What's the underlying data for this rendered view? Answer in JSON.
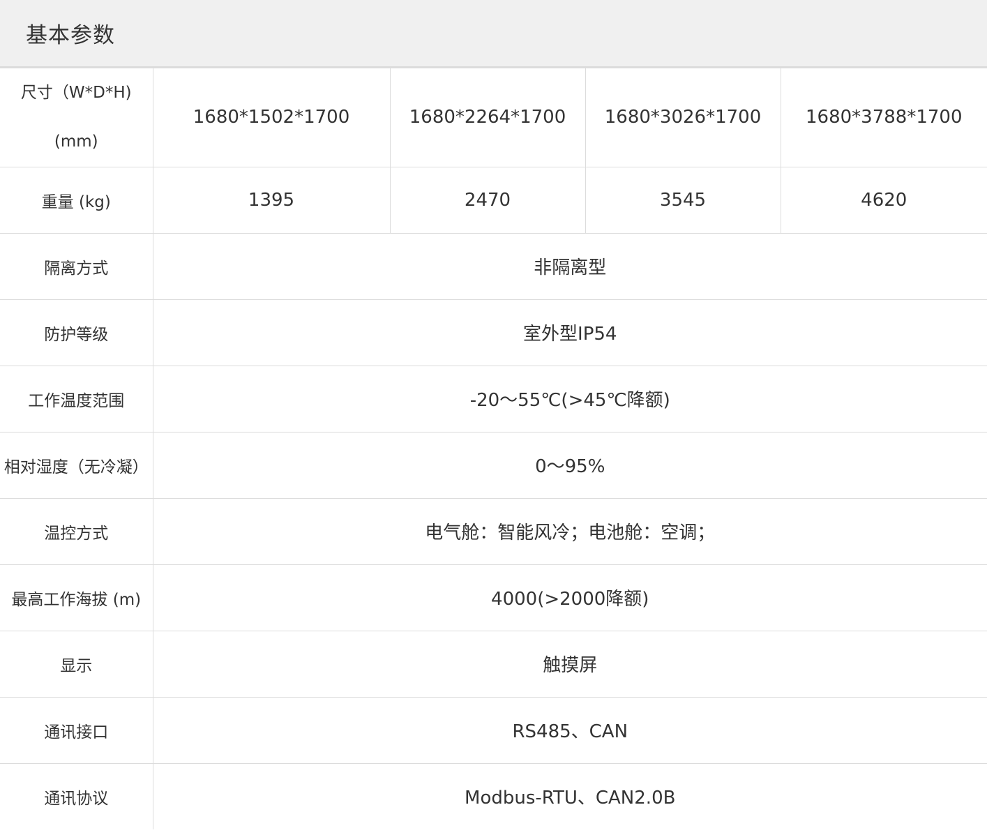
{
  "section": {
    "title": "基本参数"
  },
  "size_row": {
    "label_line1": "尺寸（W*D*H)",
    "label_line2": "(mm)",
    "values": [
      "1680*1502*1700",
      "1680*2264*1700",
      "1680*3026*1700",
      "1680*3788*1700"
    ]
  },
  "weight_row": {
    "label": "重量 (kg)",
    "values": [
      "1395",
      "2470",
      "3545",
      "4620"
    ]
  },
  "rows": [
    {
      "label": "隔离方式",
      "value": "非隔离型"
    },
    {
      "label": "防护等级",
      "value": "室外型IP54"
    },
    {
      "label": "工作温度范围",
      "value": "-20～55℃(>45℃降额)"
    },
    {
      "label": "相对湿度（无冷凝）",
      "value": "0～95%"
    },
    {
      "label": "温控方式",
      "value": "电气舱：智能风冷；电池舱：空调；"
    },
    {
      "label": "最高工作海拔 (m)",
      "value": "4000(>2000降额)"
    },
    {
      "label": "显示",
      "value": "触摸屏"
    },
    {
      "label": "通讯接口",
      "value": "RS485、CAN"
    },
    {
      "label": "通讯协议",
      "value": "Modbus-RTU、CAN2.0B"
    }
  ]
}
